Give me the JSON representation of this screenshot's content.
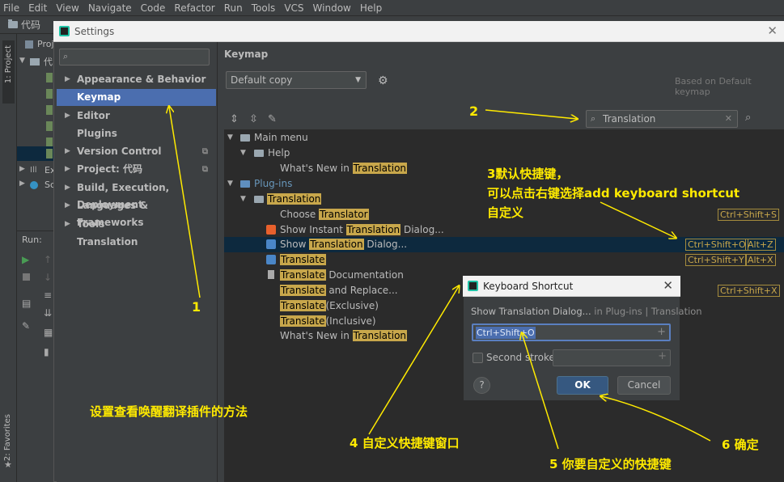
{
  "menubar": [
    "File",
    "Edit",
    "View",
    "Navigate",
    "Code",
    "Refactor",
    "Run",
    "Tools",
    "VCS",
    "Window",
    "Help"
  ],
  "navbar": {
    "crumb": "代码"
  },
  "left_strip": {
    "project_tab": "1: Project",
    "favorites_tab": "2: Favorites"
  },
  "project_panel": {
    "header": "Proj",
    "root": "代",
    "ext1": "Ex",
    "ext2": "Sc"
  },
  "run_panel": {
    "label": "Run:"
  },
  "dialog": {
    "title": "Settings",
    "close": "✕"
  },
  "sidebar": {
    "search_placeholder": "",
    "items": [
      {
        "label": "Appearance & Behavior",
        "arrow": "▶"
      },
      {
        "label": "Keymap",
        "arrow": ""
      },
      {
        "label": "Editor",
        "arrow": "▶"
      },
      {
        "label": "Plugins",
        "arrow": ""
      },
      {
        "label": "Version Control",
        "arrow": "▶"
      },
      {
        "label": "Project: 代码",
        "arrow": "▶"
      },
      {
        "label": "Build, Execution, Deployment",
        "arrow": "▶"
      },
      {
        "label": "Languages & Frameworks",
        "arrow": "▶"
      },
      {
        "label": "Tools",
        "arrow": "▶"
      },
      {
        "label": "Translation",
        "arrow": ""
      }
    ]
  },
  "keymap": {
    "title": "Keymap",
    "scheme": "Default copy",
    "based_on": "Based on Default keymap",
    "search_value": "Translation"
  },
  "tree": {
    "main_menu": "Main menu",
    "help": "Help",
    "whats_new_prefix": "What's New in ",
    "translation": "Translation",
    "plugins": "Plug-ins",
    "choose_prefix": "Choose ",
    "translator": "Translator",
    "show_instant_prefix": "Show Instant ",
    "dialog_suffix": " Dialog...",
    "show_prefix": "Show ",
    "translate": "Translate",
    "documentation": " Documentation",
    "and_replace": " and Replace...",
    "exclusive": "(Exclusive)",
    "inclusive": "(Inclusive)",
    "sc_ctrl_shift_s": "Ctrl+Shift+S",
    "sc_ctrl_shift_o": "Ctrl+Shift+O",
    "sc_alt_z": "Alt+Z",
    "sc_ctrl_shift_y": "Ctrl+Shift+Y",
    "sc_alt_x": "Alt+X",
    "sc_ctrl_shift_x": "Ctrl+Shift+X"
  },
  "shortcut_dialog": {
    "title": "Keyboard Shortcut",
    "action": "Show Translation Dialog...",
    "path": " in Plug-ins | Translation",
    "first_stroke": "Ctrl+Shift+O",
    "second_stroke_label": "Second stroke:",
    "help": "?",
    "ok": "OK",
    "cancel": "Cancel"
  },
  "annotations": {
    "n1": "1",
    "n2": "2",
    "n3_line1": "3默认快捷键，",
    "n3_line2": "可以点击右键选择add keyboard shortcut",
    "n3_line3": "自定义",
    "n4": "4 自定义快捷键窗口",
    "n5": "5 你要自定义的快捷键",
    "n6": "6  确定",
    "caption": "设置查看唤醒翻译插件的方法",
    "color": "#ffea00"
  },
  "colors": {
    "selection": "#4b6eaf",
    "highlight": "#c8a74b",
    "background": "#3c3f41",
    "tree_bg": "#2b2b2b"
  }
}
